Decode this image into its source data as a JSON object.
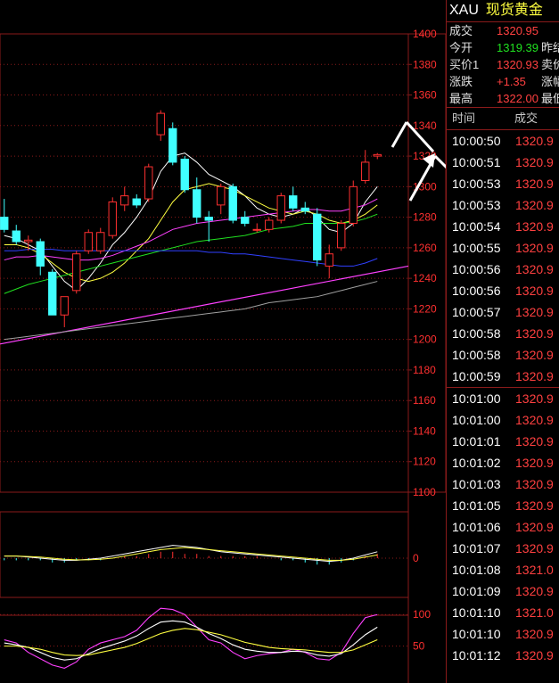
{
  "quote": {
    "symbol": "XAU",
    "name": "现货黄金",
    "rows": [
      {
        "label": "成交",
        "value": "1320.95",
        "color": "#ff4040",
        "label2": ""
      },
      {
        "label": "今开",
        "value": "1319.39",
        "color": "#20e020",
        "label2": "昨结"
      },
      {
        "label": "买价1",
        "value": "1320.93",
        "color": "#ff4040",
        "label2": "卖价"
      },
      {
        "label": "涨跌",
        "value": "+1.35",
        "color": "#ff4040",
        "label2": "涨幅"
      },
      {
        "label": "最高",
        "value": "1322.00",
        "color": "#ff4040",
        "label2": "最低"
      }
    ]
  },
  "trades": {
    "col_time": "时间",
    "col_price": "成交",
    "rows": [
      {
        "time": "10:00:50",
        "price": "1320.9"
      },
      {
        "time": "10:00:51",
        "price": "1320.9"
      },
      {
        "time": "10:00:53",
        "price": "1320.9"
      },
      {
        "time": "10:00:53",
        "price": "1320.9"
      },
      {
        "time": "10:00:54",
        "price": "1320.9"
      },
      {
        "time": "10:00:55",
        "price": "1320.9"
      },
      {
        "time": "10:00:56",
        "price": "1320.9"
      },
      {
        "time": "10:00:56",
        "price": "1320.9"
      },
      {
        "time": "10:00:57",
        "price": "1320.9"
      },
      {
        "time": "10:00:58",
        "price": "1320.9"
      },
      {
        "time": "10:00:58",
        "price": "1320.9"
      },
      {
        "time": "10:00:59",
        "price": "1320.9"
      },
      {
        "time": "10:01:00",
        "price": "1320.9"
      },
      {
        "time": "10:01:00",
        "price": "1320.9"
      },
      {
        "time": "10:01:01",
        "price": "1320.9"
      },
      {
        "time": "10:01:02",
        "price": "1320.9"
      },
      {
        "time": "10:01:03",
        "price": "1320.9"
      },
      {
        "time": "10:01:05",
        "price": "1320.9"
      },
      {
        "time": "10:01:06",
        "price": "1320.9"
      },
      {
        "time": "10:01:07",
        "price": "1320.9"
      },
      {
        "time": "10:01:08",
        "price": "1321.0"
      },
      {
        "time": "10:01:09",
        "price": "1320.9"
      },
      {
        "time": "10:01:10",
        "price": "1321.0"
      },
      {
        "time": "10:01:10",
        "price": "1320.9"
      },
      {
        "time": "10:01:12",
        "price": "1320.9"
      }
    ]
  },
  "chart_data": [
    {
      "type": "candlestick",
      "ylim": [
        1100,
        1400
      ],
      "y_ticks": [
        "1400",
        "1380",
        "1360",
        "1340",
        "1320",
        "1300",
        "1280",
        "1260",
        "1240",
        "1220",
        "1200",
        "1180",
        "1160",
        "1140",
        "1120",
        "1100"
      ],
      "colors": {
        "up": "#ff3030",
        "down": "#40ffff",
        "grid": "#8a1a1a",
        "axis_text": "#ff3030"
      },
      "candles": [
        {
          "o": 1280,
          "h": 1292,
          "l": 1270,
          "c": 1272
        },
        {
          "o": 1271,
          "h": 1275,
          "l": 1262,
          "c": 1264
        },
        {
          "o": 1264,
          "h": 1268,
          "l": 1258,
          "c": 1265
        },
        {
          "o": 1264,
          "h": 1266,
          "l": 1242,
          "c": 1248
        },
        {
          "o": 1244,
          "h": 1246,
          "l": 1216,
          "c": 1216
        },
        {
          "o": 1216,
          "h": 1228,
          "l": 1208,
          "c": 1228
        },
        {
          "o": 1232,
          "h": 1258,
          "l": 1230,
          "c": 1256
        },
        {
          "o": 1258,
          "h": 1272,
          "l": 1256,
          "c": 1270
        },
        {
          "o": 1258,
          "h": 1273,
          "l": 1256,
          "c": 1270
        },
        {
          "o": 1268,
          "h": 1293,
          "l": 1266,
          "c": 1290
        },
        {
          "o": 1288,
          "h": 1300,
          "l": 1284,
          "c": 1294
        },
        {
          "o": 1292,
          "h": 1295,
          "l": 1286,
          "c": 1288
        },
        {
          "o": 1292,
          "h": 1315,
          "l": 1290,
          "c": 1313
        },
        {
          "o": 1334,
          "h": 1350,
          "l": 1330,
          "c": 1348
        },
        {
          "o": 1338,
          "h": 1342,
          "l": 1314,
          "c": 1316
        },
        {
          "o": 1318,
          "h": 1320,
          "l": 1296,
          "c": 1298
        },
        {
          "o": 1298,
          "h": 1306,
          "l": 1276,
          "c": 1280
        },
        {
          "o": 1280,
          "h": 1284,
          "l": 1264,
          "c": 1278
        },
        {
          "o": 1288,
          "h": 1302,
          "l": 1282,
          "c": 1300
        },
        {
          "o": 1300,
          "h": 1302,
          "l": 1276,
          "c": 1278
        },
        {
          "o": 1280,
          "h": 1284,
          "l": 1274,
          "c": 1276
        },
        {
          "o": 1272,
          "h": 1276,
          "l": 1270,
          "c": 1272
        },
        {
          "o": 1272,
          "h": 1280,
          "l": 1270,
          "c": 1278
        },
        {
          "o": 1278,
          "h": 1296,
          "l": 1276,
          "c": 1294
        },
        {
          "o": 1294,
          "h": 1300,
          "l": 1284,
          "c": 1286
        },
        {
          "o": 1286,
          "h": 1290,
          "l": 1282,
          "c": 1284
        },
        {
          "o": 1282,
          "h": 1286,
          "l": 1248,
          "c": 1252
        },
        {
          "o": 1248,
          "h": 1262,
          "l": 1240,
          "c": 1256
        },
        {
          "o": 1260,
          "h": 1278,
          "l": 1258,
          "c": 1276
        },
        {
          "o": 1276,
          "h": 1304,
          "l": 1274,
          "c": 1300
        },
        {
          "o": 1304,
          "h": 1324,
          "l": 1302,
          "c": 1316
        },
        {
          "o": 1320,
          "h": 1322,
          "l": 1318,
          "c": 1321
        }
      ],
      "ma_lines": [
        {
          "color": "#ffffff",
          "values": [
            1268,
            1266,
            1262,
            1258,
            1248,
            1238,
            1232,
            1240,
            1250,
            1262,
            1270,
            1280,
            1292,
            1310,
            1320,
            1322,
            1316,
            1308,
            1304,
            1300,
            1294,
            1286,
            1282,
            1280,
            1282,
            1286,
            1280,
            1272,
            1270,
            1276,
            1290,
            1300
          ]
        },
        {
          "color": "#ffff40",
          "values": [
            1262,
            1262,
            1260,
            1256,
            1250,
            1244,
            1240,
            1238,
            1240,
            1244,
            1250,
            1258,
            1266,
            1278,
            1290,
            1298,
            1300,
            1302,
            1300,
            1298,
            1294,
            1290,
            1286,
            1284,
            1282,
            1284,
            1282,
            1278,
            1276,
            1278,
            1282,
            1288
          ]
        },
        {
          "color": "#ff40ff",
          "values": [
            1252,
            1254,
            1254,
            1255,
            1254,
            1253,
            1252,
            1252,
            1253,
            1255,
            1258,
            1261,
            1264,
            1268,
            1272,
            1274,
            1276,
            1277,
            1278,
            1279,
            1280,
            1281,
            1282,
            1283,
            1284,
            1285,
            1285,
            1284,
            1284,
            1286,
            1288,
            1292
          ]
        },
        {
          "color": "#20e020",
          "values": [
            1230,
            1233,
            1236,
            1238,
            1240,
            1242,
            1244,
            1246,
            1248,
            1250,
            1252,
            1254,
            1256,
            1258,
            1260,
            1262,
            1264,
            1265,
            1266,
            1267,
            1268,
            1270,
            1272,
            1273,
            1274,
            1276,
            1276,
            1276,
            1276,
            1277,
            1279,
            1282
          ]
        },
        {
          "color": "#3040ff",
          "values": [
            1258,
            1258,
            1259,
            1259,
            1259,
            1258,
            1258,
            1258,
            1258,
            1258,
            1258,
            1258,
            1258,
            1258,
            1258,
            1258,
            1258,
            1257,
            1257,
            1256,
            1256,
            1255,
            1254,
            1253,
            1252,
            1251,
            1250,
            1249,
            1248,
            1248,
            1250,
            1253
          ]
        },
        {
          "color": "#a0a0a0",
          "values": [
            1200,
            1201,
            1202,
            1203,
            1204,
            1205,
            1206,
            1207,
            1208,
            1209,
            1210,
            1211,
            1212,
            1213,
            1214,
            1215,
            1216,
            1217,
            1218,
            1219,
            1220,
            1222,
            1224,
            1225,
            1226,
            1227,
            1228,
            1230,
            1232,
            1234,
            1236,
            1238
          ]
        }
      ],
      "trendline": {
        "color": "#ff40ff",
        "from": 1197,
        "to": 1248
      }
    },
    {
      "type": "bar",
      "y_ticks": [
        "0"
      ],
      "colors": {
        "pos": "#ff3030",
        "neg": "#40ffff"
      },
      "values": [
        -1,
        -1,
        -1,
        -1,
        -2,
        -2,
        -1,
        -1,
        -1,
        0,
        1,
        1,
        2,
        3,
        3,
        2,
        2,
        1,
        1,
        1,
        1,
        1,
        0,
        -1,
        -1,
        -2,
        -3,
        -3,
        -2,
        -1,
        1,
        2
      ],
      "lines": [
        {
          "color": "#ffffff",
          "values": [
            1,
            1,
            0.5,
            0,
            -0.5,
            -1,
            -1,
            -0.5,
            0,
            1,
            2,
            3,
            4,
            5,
            6,
            5.5,
            5,
            4,
            3,
            2.5,
            2,
            1.5,
            1,
            0.5,
            0,
            -0.5,
            -1,
            -1.5,
            -1,
            0,
            1.5,
            3
          ]
        },
        {
          "color": "#ffff40",
          "values": [
            1,
            1,
            0.8,
            0.5,
            0,
            -0.5,
            -0.8,
            -0.8,
            -0.5,
            0,
            1,
            2,
            3,
            4,
            4.5,
            5,
            4.5,
            4,
            3.5,
            3,
            2.5,
            2,
            1.5,
            1,
            0.5,
            0,
            -0.5,
            -1,
            -1,
            -0.5,
            0.5,
            1.5
          ]
        }
      ]
    },
    {
      "type": "line",
      "y_ticks": [
        "100",
        "50"
      ],
      "ylim": [
        0,
        130
      ],
      "series": [
        {
          "color": "#ff40ff",
          "values": [
            60,
            55,
            40,
            30,
            20,
            15,
            25,
            45,
            55,
            60,
            65,
            75,
            95,
            110,
            108,
            100,
            80,
            60,
            55,
            40,
            30,
            35,
            38,
            40,
            45,
            40,
            30,
            28,
            40,
            70,
            95,
            100
          ]
        },
        {
          "color": "#ffffff",
          "values": [
            55,
            52,
            48,
            40,
            32,
            28,
            30,
            38,
            46,
            52,
            58,
            66,
            78,
            88,
            90,
            88,
            80,
            70,
            62,
            52,
            45,
            42,
            40,
            40,
            42,
            41,
            36,
            34,
            38,
            52,
            68,
            80
          ]
        },
        {
          "color": "#ffff40",
          "values": [
            50,
            50,
            48,
            45,
            40,
            36,
            35,
            36,
            40,
            44,
            48,
            54,
            62,
            70,
            75,
            78,
            76,
            72,
            68,
            62,
            56,
            52,
            48,
            46,
            45,
            44,
            42,
            40,
            40,
            44,
            52,
            60
          ]
        }
      ]
    }
  ]
}
